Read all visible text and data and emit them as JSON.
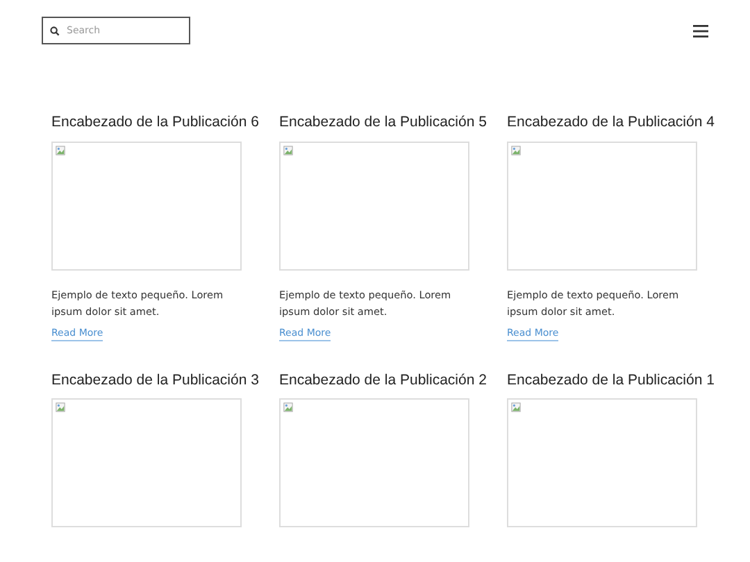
{
  "search": {
    "placeholder": "Search"
  },
  "posts": [
    {
      "heading": "Encabezado de la Publicación 6",
      "text": "Ejemplo de texto pequeño. Lorem ipsum dolor sit amet.",
      "link": "Read More"
    },
    {
      "heading": "Encabezado de la Publicación 5",
      "text": "Ejemplo de texto pequeño. Lorem ipsum dolor sit amet.",
      "link": "Read More"
    },
    {
      "heading": "Encabezado de la Publicación 4",
      "text": "Ejemplo de texto pequeño. Lorem ipsum dolor sit amet.",
      "link": "Read More"
    },
    {
      "heading": "Encabezado de la Publicación 3"
    },
    {
      "heading": "Encabezado de la Publicación 2"
    },
    {
      "heading": "Encabezado de la Publicación 1"
    }
  ]
}
